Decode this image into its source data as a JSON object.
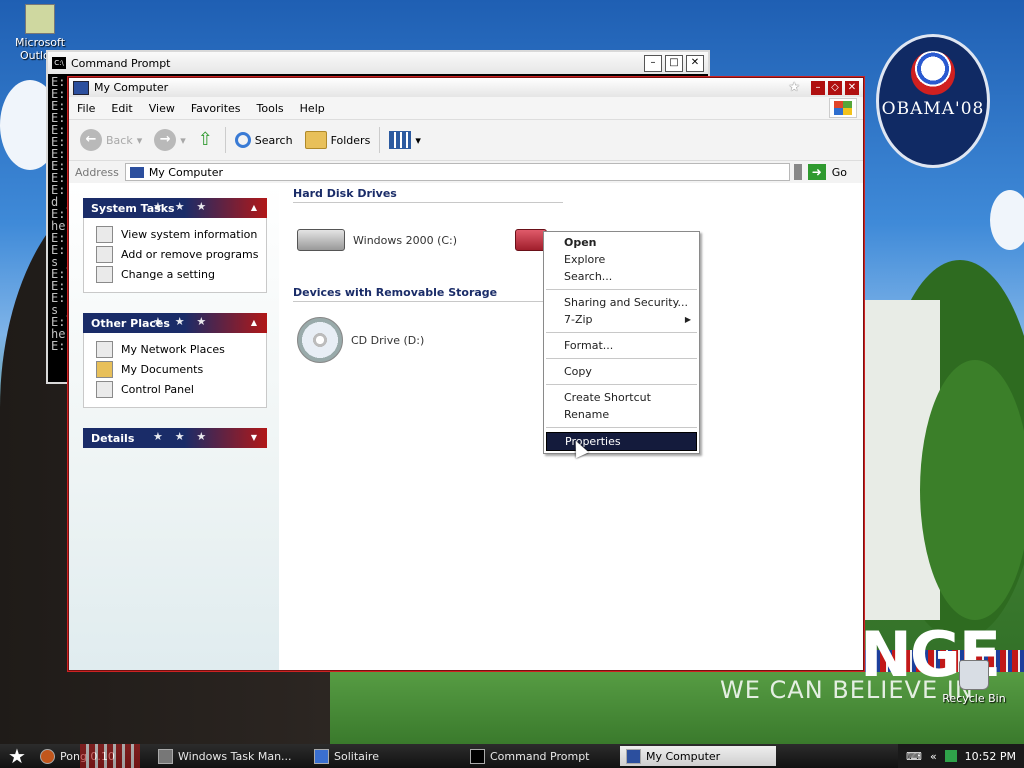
{
  "desktop": {
    "icons": [
      {
        "label": "Microsoft Outlo...",
        "name": "outlook"
      },
      {
        "label": "Recycle Bin",
        "name": "recycle-bin"
      }
    ],
    "wallpaper": {
      "logo_text": "OBAMA'08",
      "change_text": "NGE",
      "believe_text": "WE CAN BELIEVE IN"
    }
  },
  "cmd_window": {
    "title": "Command Prompt",
    "lines": [
      "E:",
      "E:",
      "E:",
      "E:",
      "E:",
      "E:",
      "E:",
      "E:",
      "E:",
      "E:",
      "d j",
      "E:",
      "he:",
      "E:",
      "E:",
      "s j",
      "E:",
      "E:",
      "E:",
      "s j",
      "E:",
      "he:",
      "E:"
    ]
  },
  "explorer": {
    "title": "My Computer",
    "menu": [
      "File",
      "Edit",
      "View",
      "Favorites",
      "Tools",
      "Help"
    ],
    "toolbar": {
      "back": "Back",
      "search": "Search",
      "folders": "Folders"
    },
    "address": {
      "label": "Address",
      "value": "My Computer",
      "go": "Go"
    },
    "panels": {
      "system_tasks": {
        "title": "System Tasks",
        "items": [
          "View system information",
          "Add or remove programs",
          "Change a setting"
        ]
      },
      "other_places": {
        "title": "Other Places",
        "items": [
          "My Network Places",
          "My Documents",
          "Control Panel"
        ]
      },
      "details": {
        "title": "Details"
      }
    },
    "groups": {
      "hard_disk": {
        "title": "Hard Disk Drives",
        "drives": [
          "Windows 2000 (C:)"
        ]
      },
      "removable": {
        "title": "Devices with Removable Storage",
        "drives": [
          "CD Drive (D:)"
        ]
      }
    }
  },
  "context_menu": {
    "items": [
      "Open",
      "Explore",
      "Search...",
      "Sharing and Security...",
      "7-Zip",
      "Format...",
      "Copy",
      "Create Shortcut",
      "Rename",
      "Properties"
    ],
    "selected": "Properties"
  },
  "taskbar": {
    "items": [
      "Pong 0.10",
      "Windows Task Man...",
      "Solitaire",
      "Command Prompt",
      "My Computer"
    ],
    "active": "My Computer",
    "clock": "10:52 PM"
  },
  "colors": {
    "accent_blue": "#1a2c68",
    "accent_red": "#b11818",
    "selection": "#141b3c"
  }
}
